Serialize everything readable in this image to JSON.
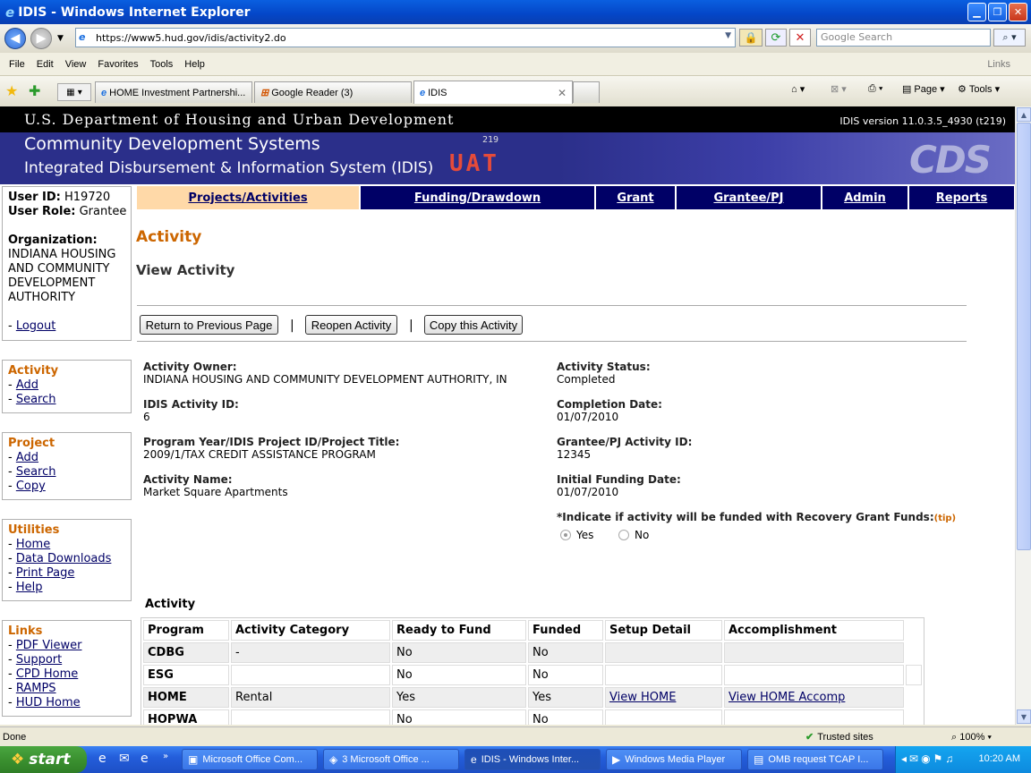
{
  "window": {
    "title": "IDIS - Windows Internet Explorer"
  },
  "browser": {
    "address": "https://www5.hud.gov/idis/activity2.do",
    "search_placeholder": "Google Search",
    "menu": [
      "File",
      "Edit",
      "View",
      "Favorites",
      "Tools",
      "Help"
    ],
    "links_label": "Links",
    "tabs": [
      {
        "label": "HOME Investment Partnershi..."
      },
      {
        "label": "Google Reader (3)"
      },
      {
        "label": "IDIS"
      }
    ],
    "tools": {
      "page": "Page",
      "tools": "Tools"
    }
  },
  "header": {
    "agency": "U.S. Department of Housing and Urban Development",
    "version": "IDIS version 11.0.3.5_4930 (t219)",
    "system1": "Community Development Systems",
    "system2": "Integrated Disbursement & Information System (IDIS)",
    "env_num": "219",
    "env": "UAT",
    "logo": "CDS"
  },
  "nav": {
    "items": [
      {
        "label": "Projects/Activities"
      },
      {
        "label": "Funding/Drawdown"
      },
      {
        "label": "Grant"
      },
      {
        "label": "Grantee/PJ"
      },
      {
        "label": "Admin"
      },
      {
        "label": "Reports"
      }
    ]
  },
  "user": {
    "id_label": "User ID:",
    "id": "H19720",
    "role_label": "User Role:",
    "role": "Grantee",
    "org_label": "Organization:",
    "org_lines": [
      "INDIANA HOUSING",
      "AND COMMUNITY",
      "DEVELOPMENT",
      "AUTHORITY"
    ],
    "logout": "Logout"
  },
  "sidebar": {
    "activity": {
      "title": "Activity",
      "links": [
        "Add",
        "Search"
      ]
    },
    "project": {
      "title": "Project",
      "links": [
        "Add",
        "Search",
        "Copy"
      ]
    },
    "utilities": {
      "title": "Utilities",
      "links": [
        "Home",
        "Data Downloads",
        "Print Page",
        "Help"
      ]
    },
    "links": {
      "title": "Links",
      "links": [
        "PDF Viewer",
        "Support",
        "CPD Home",
        "RAMPS",
        "HUD Home"
      ]
    }
  },
  "page": {
    "title": "Activity",
    "subtitle": "View Activity",
    "buttons": {
      "back": "Return to Previous Page",
      "reopen": "Reopen Activity",
      "copy": "Copy this Activity"
    },
    "separator": "|"
  },
  "fields": {
    "owner": {
      "label": "Activity Owner:",
      "value": "INDIANA HOUSING AND COMMUNITY DEVELOPMENT AUTHORITY, IN"
    },
    "idis_id": {
      "label": "IDIS Activity ID:",
      "value": "6"
    },
    "program": {
      "label": "Program Year/IDIS Project ID/Project Title:",
      "value": "2009/1/TAX CREDIT ASSISTANCE PROGRAM"
    },
    "name": {
      "label": "Activity Name:",
      "value": "Market Square Apartments"
    },
    "status": {
      "label": "Activity Status:",
      "value": "Completed"
    },
    "completion": {
      "label": "Completion Date:",
      "value": "01/07/2010"
    },
    "grantee_id": {
      "label": "Grantee/PJ Activity ID:",
      "value": "12345"
    },
    "initial_funding": {
      "label": "Initial Funding Date:",
      "value": "01/07/2010"
    },
    "recovery": {
      "label": "*Indicate if activity will be funded with Recovery Grant Funds:",
      "tip": "(tip)",
      "yes": "Yes",
      "no": "No"
    }
  },
  "table": {
    "title": "Activity",
    "headers": [
      "Program",
      "Activity Category",
      "Ready to Fund",
      "Funded",
      "Setup Detail",
      "Accomplishment"
    ],
    "rows": [
      [
        "CDBG",
        "-",
        "No",
        "No",
        "",
        ""
      ],
      [
        "ESG",
        "",
        "No",
        "No",
        "",
        ""
      ],
      [
        "HOME",
        "Rental",
        "Yes",
        "Yes",
        "View HOME",
        "View HOME Accomp"
      ],
      [
        "HOPWA",
        "",
        "No",
        "No",
        "",
        ""
      ]
    ]
  },
  "statusbar": {
    "text": "Done",
    "zone": "Trusted sites",
    "zoom": "100%"
  },
  "taskbar": {
    "start": "start",
    "tasks": [
      {
        "label": "Microsoft Office Com..."
      },
      {
        "label": "3 Microsoft Office ..."
      },
      {
        "label": "IDIS - Windows Inter..."
      },
      {
        "label": "Windows Media Player"
      },
      {
        "label": "OMB request TCAP I..."
      }
    ],
    "clock": "10:20 AM"
  }
}
